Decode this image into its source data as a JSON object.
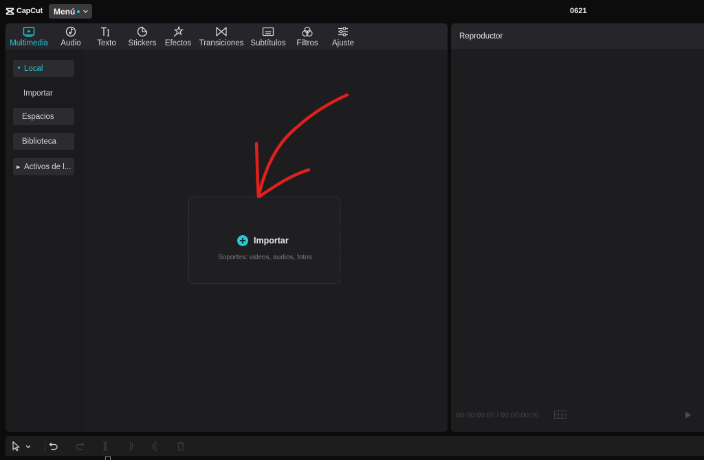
{
  "app": {
    "logo_text": "CapCut",
    "project_name": "0621"
  },
  "menu": {
    "label": "Menú"
  },
  "toolbar": {
    "tabs": [
      {
        "label": "Multimedia",
        "icon": "media-icon",
        "active": true
      },
      {
        "label": "Audio",
        "icon": "audio-icon"
      },
      {
        "label": "Texto",
        "icon": "text-icon"
      },
      {
        "label": "Stickers",
        "icon": "sticker-icon"
      },
      {
        "label": "Efectos",
        "icon": "effects-icon"
      },
      {
        "label": "Transiciones",
        "icon": "transition-icon"
      },
      {
        "label": "Subtítulos",
        "icon": "subtitles-icon"
      },
      {
        "label": "Filtros",
        "icon": "filters-icon"
      },
      {
        "label": "Ajuste",
        "icon": "adjust-icon"
      }
    ]
  },
  "side_nav": {
    "items": [
      {
        "label": "Local",
        "active": true,
        "expanded": true
      },
      {
        "label": "Importar"
      },
      {
        "label": "Espacios"
      },
      {
        "label": "Biblioteca"
      },
      {
        "label": "Activos de l..."
      }
    ]
  },
  "import_zone": {
    "label": "Importar",
    "support_text": "Soportes: videos, audios, fotos"
  },
  "player": {
    "title": "Reproductor",
    "timecode": "00:00:00:00 / 00:00:00:00"
  },
  "colors": {
    "accent": "#21c8d6",
    "annotation": "#e0201b",
    "panel": "#1d1d20",
    "background": "#0c0c0d"
  }
}
